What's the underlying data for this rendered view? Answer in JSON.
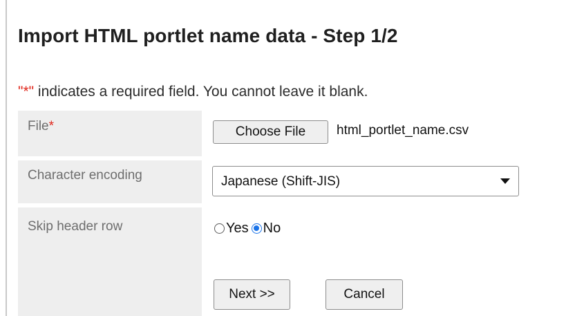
{
  "header": {
    "title": "Import HTML portlet name data - Step 1/2"
  },
  "required_note": {
    "marker": "\"*\"",
    "text": " indicates a required field. You cannot leave it blank."
  },
  "form": {
    "file": {
      "label": "File",
      "required_mark": "*",
      "button_label": "Choose File",
      "selected_file": "html_portlet_name.csv"
    },
    "encoding": {
      "label": "Character encoding",
      "selected": "Japanese (Shift-JIS)"
    },
    "skip_header": {
      "label": "Skip header row",
      "options": [
        {
          "label": "Yes",
          "checked": false
        },
        {
          "label": "No",
          "checked": true
        }
      ]
    }
  },
  "actions": {
    "next_label": "Next >>",
    "cancel_label": "Cancel"
  },
  "colors": {
    "required": "#e0261b",
    "radio_selected": "#1a73e8",
    "label_background": "#eeeeee"
  }
}
